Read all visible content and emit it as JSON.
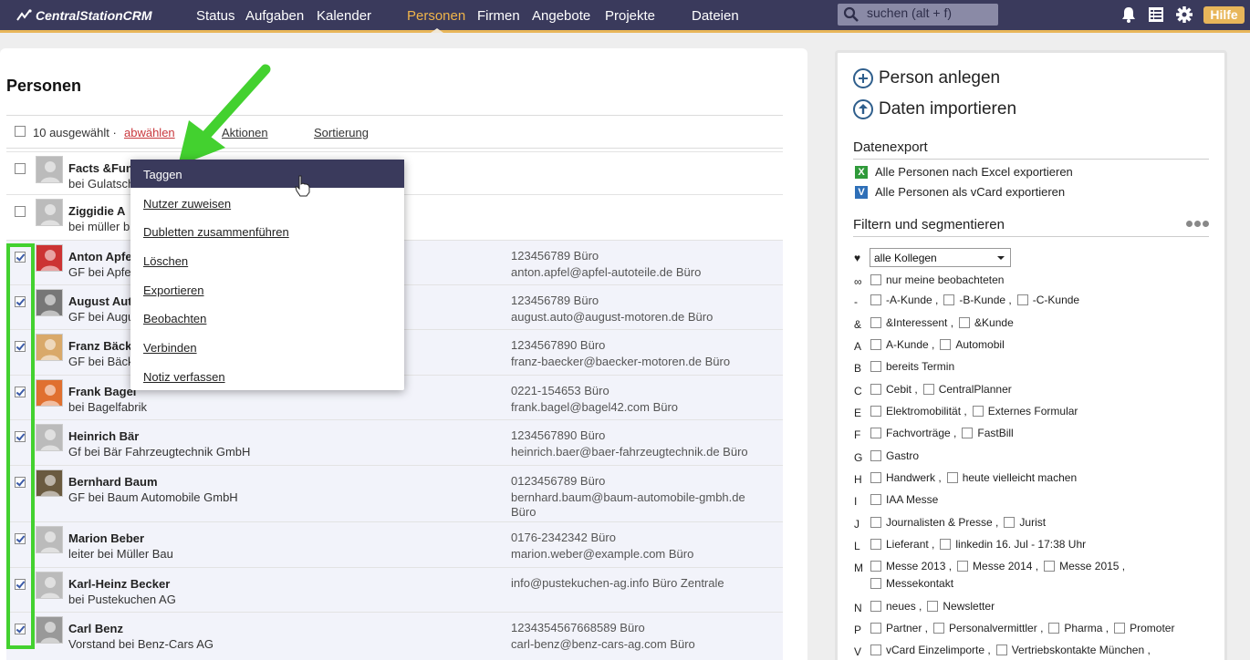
{
  "app": {
    "name": "CentralStationCRM"
  },
  "nav": {
    "items": [
      "Status",
      "Aufgaben",
      "Kalender",
      "Personen",
      "Firmen",
      "Angebote",
      "Projekte",
      "Dateien"
    ],
    "active": "Personen",
    "search_placeholder": "suchen (alt + f)",
    "help": "Hilfe"
  },
  "page": {
    "title": "Personen"
  },
  "toolbar": {
    "selected_text": "10 ausgewählt ·",
    "deselect": "abwählen",
    "actions": "Aktionen",
    "sort": "Sortierung"
  },
  "dropdown": {
    "items": [
      "Taggen",
      "Nutzer zuweisen",
      "Dubletten zusammenführen",
      "Löschen",
      "Exportieren",
      "Beobachten",
      "Verbinden",
      "Notiz verfassen"
    ],
    "highlighted": "Taggen"
  },
  "people": [
    {
      "name": "Facts &Fun",
      "company": "bei Gulatsch",
      "phone": "",
      "email": "",
      "checked": false
    },
    {
      "name": "Ziggidie A",
      "company": "bei müller b",
      "phone": "",
      "email": "",
      "checked": false
    },
    {
      "name": "Anton Apfel",
      "company": "GF bei Apfel",
      "phone": "123456789 Büro",
      "email": "anton.apfel@apfel-autoteile.de Büro",
      "checked": true
    },
    {
      "name": "August Auto",
      "company": "GF bei August",
      "phone": "123456789 Büro",
      "email": "august.auto@august-motoren.de Büro",
      "checked": true
    },
    {
      "name": "Franz Bäcker",
      "company": "GF bei Bäcker",
      "phone": "1234567890 Büro",
      "email": "franz-baecker@baecker-motoren.de Büro",
      "checked": true
    },
    {
      "name": "Frank Bagel",
      "company": "bei Bagelfabrik",
      "phone": "0221-154653 Büro",
      "email": "frank.bagel@bagel42.com Büro",
      "checked": true
    },
    {
      "name": "Heinrich Bär",
      "company": "Gf bei Bär Fahrzeugtechnik GmbH",
      "phone": "1234567890 Büro",
      "email": "heinrich.baer@baer-fahrzeugtechnik.de Büro",
      "checked": true
    },
    {
      "name": "Bernhard Baum",
      "company": "GF bei Baum Automobile GmbH",
      "phone": "0123456789 Büro",
      "email": "bernhard.baum@baum-automobile-gmbh.de",
      "email2": "Büro",
      "checked": true
    },
    {
      "name": "Marion Beber",
      "company": "leiter bei Müller Bau",
      "phone": "0176-2342342 Büro",
      "email": "marion.weber@example.com Büro",
      "checked": true
    },
    {
      "name": "Karl-Heinz Becker",
      "company": "bei Pustekuchen AG",
      "phone": "info@pustekuchen-ag.info Büro Zentrale",
      "email": "",
      "checked": true
    },
    {
      "name": "Carl Benz",
      "company": "Vorstand bei Benz-Cars AG",
      "phone": "1234354567668589 Büro",
      "email": "carl-benz@benz-cars-ag.com Büro",
      "checked": true
    }
  ],
  "sidebar": {
    "add_person": "Person anlegen",
    "import": "Daten importieren",
    "export_title": "Datenexport",
    "export_excel": "Alle Personen nach Excel exportieren",
    "export_vcard": "Alle Personen als vCard exportieren",
    "filter_title": "Filtern und segmentieren",
    "colleague_select": "alle Kollegen",
    "filters": [
      {
        "letter": "♥",
        "options": []
      },
      {
        "letter": "∞",
        "options": [
          "nur meine beobachteten"
        ]
      },
      {
        "letter": "-",
        "options": [
          "-A-Kunde ,",
          "-B-Kunde ,",
          "-C-Kunde"
        ]
      },
      {
        "letter": "&",
        "options": [
          "&Interessent ,",
          "&Kunde"
        ]
      },
      {
        "letter": "A",
        "options": [
          "A-Kunde ,",
          "Automobil"
        ]
      },
      {
        "letter": "B",
        "options": [
          "bereits Termin"
        ]
      },
      {
        "letter": "C",
        "options": [
          "Cebit ,",
          "CentralPlanner"
        ]
      },
      {
        "letter": "E",
        "options": [
          "Elektromobilität ,",
          "Externes Formular"
        ]
      },
      {
        "letter": "F",
        "options": [
          "Fachvorträge ,",
          "FastBill"
        ]
      },
      {
        "letter": "G",
        "options": [
          "Gastro"
        ]
      },
      {
        "letter": "H",
        "options": [
          "Handwerk ,",
          "heute vielleicht machen"
        ]
      },
      {
        "letter": "I",
        "options": [
          "IAA Messe"
        ]
      },
      {
        "letter": "J",
        "options": [
          "Journalisten & Presse ,",
          "Jurist"
        ]
      },
      {
        "letter": "L",
        "options": [
          "Lieferant ,",
          "linkedin 16. Jul - 17:38 Uhr"
        ]
      },
      {
        "letter": "M",
        "options": [
          "Messe 2013 ,",
          "Messe 2014 ,",
          "Messe 2015 ,"
        ]
      },
      {
        "letter": "",
        "options": [
          "Messekontakt"
        ]
      },
      {
        "letter": "N",
        "options": [
          "neues ,",
          "Newsletter"
        ]
      },
      {
        "letter": "P",
        "options": [
          "Partner ,",
          "Personalvermittler ,",
          "Pharma ,",
          "Promoter"
        ]
      },
      {
        "letter": "V",
        "options": [
          "vCard Einzelimporte ,",
          "Vertriebskontakte München ,"
        ]
      }
    ]
  }
}
